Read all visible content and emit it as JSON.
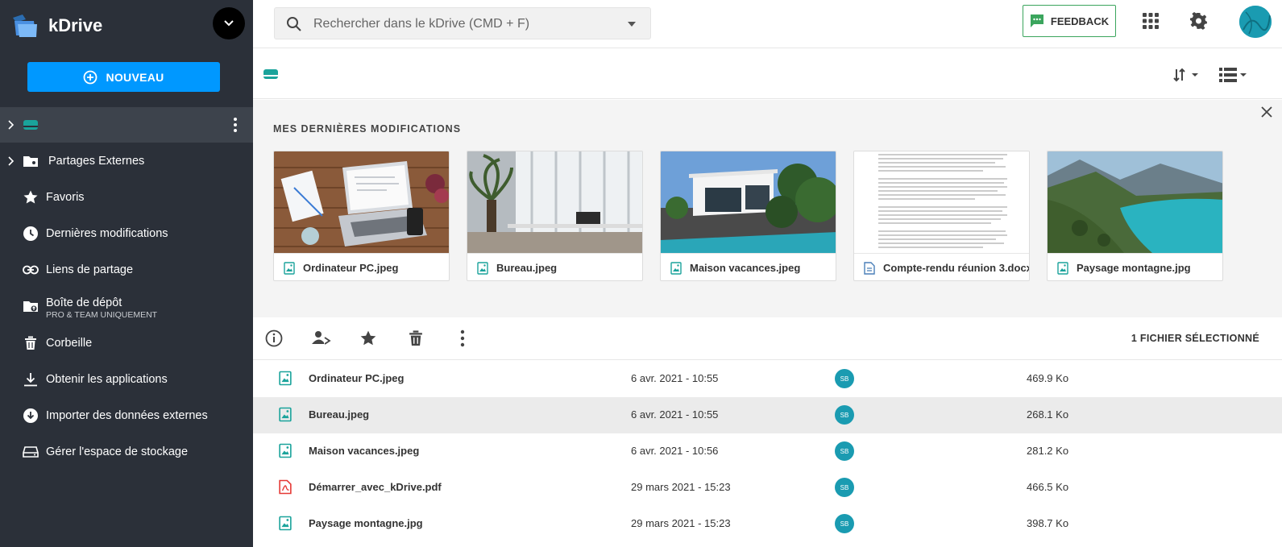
{
  "app": {
    "name": "kDrive"
  },
  "sidebar": {
    "new_button": "NOUVEAU",
    "items": [
      {
        "label": ""
      },
      {
        "label": "Partages Externes"
      },
      {
        "label": "Favoris"
      },
      {
        "label": "Dernières modifications"
      },
      {
        "label": "Liens de partage"
      },
      {
        "label": "Boîte de dépôt",
        "sublabel": "PRO & TEAM UNIQUEMENT"
      },
      {
        "label": "Corbeille"
      },
      {
        "label": "Obtenir les applications"
      },
      {
        "label": "Importer des données externes"
      },
      {
        "label": "Gérer l'espace de stockage"
      }
    ]
  },
  "search": {
    "placeholder": "Rechercher dans le kDrive (CMD + F)"
  },
  "header": {
    "feedback_label": "FEEDBACK"
  },
  "recent": {
    "title": "MES DERNIÈRES MODIFICATIONS",
    "cards": [
      {
        "name": "Ordinateur PC.jpeg",
        "icon": "image-file-icon"
      },
      {
        "name": "Bureau.jpeg",
        "icon": "image-file-icon"
      },
      {
        "name": "Maison vacances.jpeg",
        "icon": "image-file-icon"
      },
      {
        "name": "Compte-rendu réunion 3.docx",
        "icon": "document-file-icon"
      },
      {
        "name": "Paysage montagne.jpg",
        "icon": "image-file-icon"
      }
    ]
  },
  "toolbar": {
    "selection_label": "1 FICHIER SÉLECTIONNÉ"
  },
  "files": [
    {
      "name": "Ordinateur PC.jpeg",
      "date": "6 avr. 2021 - 10:55",
      "owner": "SB",
      "size": "469.9 Ko",
      "type": "image"
    },
    {
      "name": "Bureau.jpeg",
      "date": "6 avr. 2021 - 10:55",
      "owner": "SB",
      "size": "268.1 Ko",
      "type": "image"
    },
    {
      "name": "Maison vacances.jpeg",
      "date": "6 avr. 2021 - 10:56",
      "owner": "SB",
      "size": "281.2 Ko",
      "type": "image"
    },
    {
      "name": "Démarrer_avec_kDrive.pdf",
      "date": "29 mars 2021 - 15:23",
      "owner": "SB",
      "size": "466.5 Ko",
      "type": "pdf"
    },
    {
      "name": "Paysage montagne.jpg",
      "date": "29 mars 2021 - 15:23",
      "owner": "SB",
      "size": "398.7 Ko",
      "type": "image"
    }
  ],
  "colors": {
    "sidebar_bg": "#2b3039",
    "accent_blue": "#0098ff",
    "teal": "#1a9bb1",
    "feedback_green": "#3ba55d",
    "pdf_red": "#e53935"
  }
}
